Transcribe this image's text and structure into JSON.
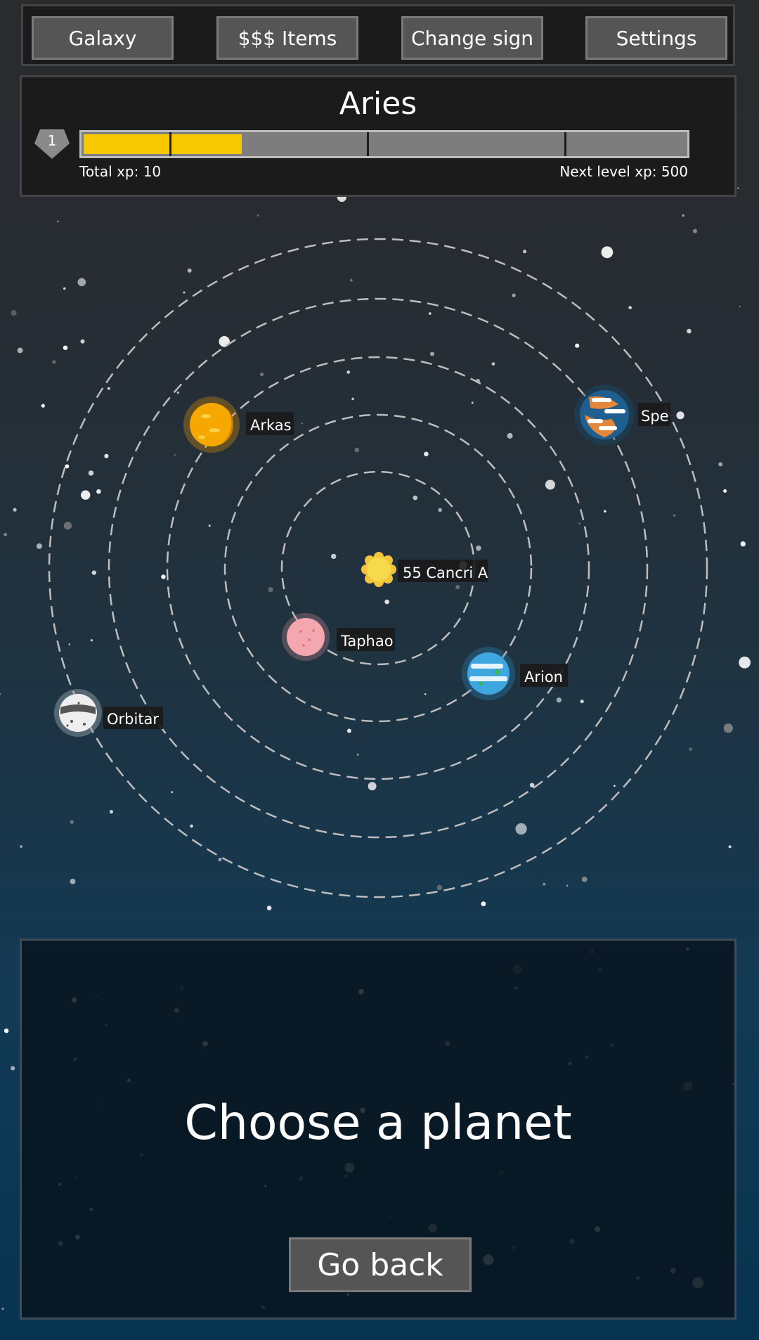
{
  "nav": {
    "galaxy": "Galaxy",
    "items": "$$$ Items",
    "change_sign": "Change sign",
    "settings": "Settings"
  },
  "level_panel": {
    "sign": "Aries",
    "level": "1",
    "progress_fraction": 0.264,
    "total_xp": "Total xp: 10",
    "next_level_xp": "Next level xp: 500"
  },
  "system": {
    "star": {
      "name": "55 Cancri A",
      "icon": "sun-icon",
      "color": "#f5d84a"
    },
    "planets": [
      {
        "name": "Taphao",
        "icon": "pink-planet-icon",
        "color": "#f4a0a8"
      },
      {
        "name": "Arion",
        "icon": "ocean-planet-icon",
        "color": "#3fa7e0"
      },
      {
        "name": "Arkas",
        "icon": "lava-planet-icon",
        "color": "#f5a000"
      },
      {
        "name": "Spe",
        "icon": "gas-giant-icon",
        "color": "#1f5f8f"
      },
      {
        "name": "Orbitar",
        "icon": "moon-planet-icon",
        "color": "#e8e8e8"
      }
    ]
  },
  "prompt": {
    "title": "Choose a planet",
    "back": "Go back"
  },
  "colors": {
    "xp_fill": "#f6c800",
    "button": "#555555",
    "orbit": "#bdbdbd"
  }
}
